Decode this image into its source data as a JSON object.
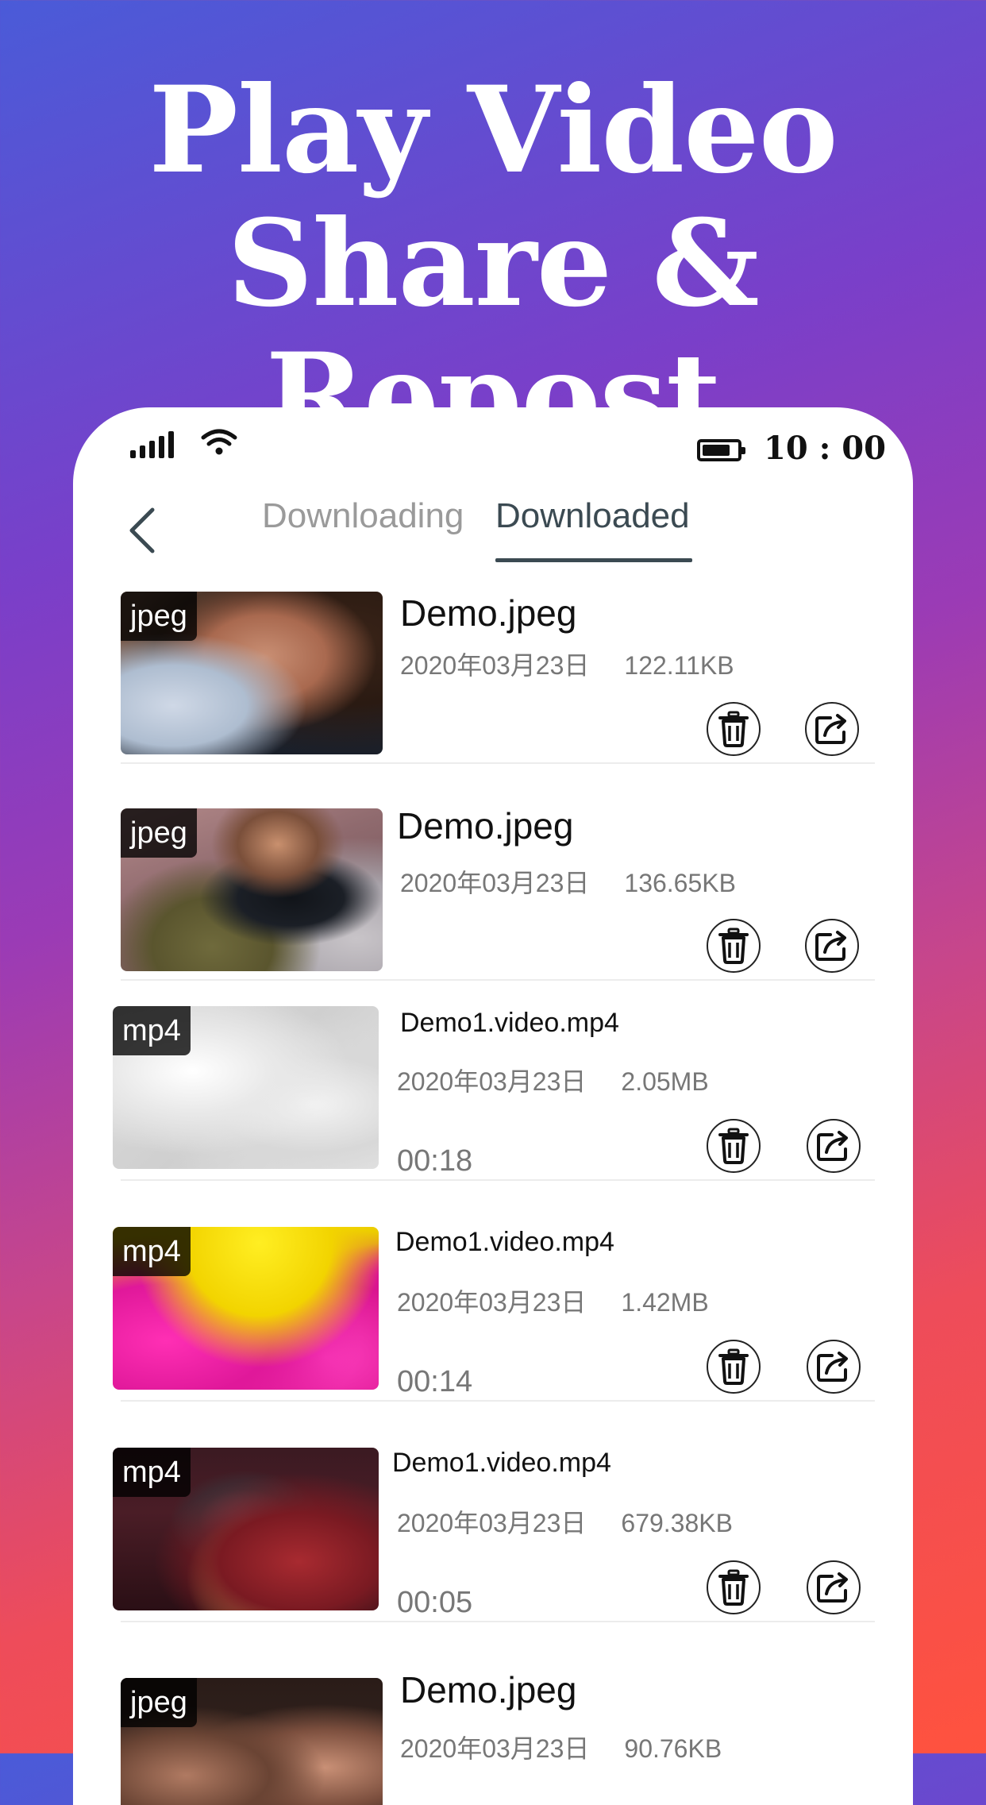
{
  "headline": {
    "line1": "Play Video",
    "line2": "Share & Repost"
  },
  "status_bar": {
    "time": "10 : 00"
  },
  "tabs": [
    {
      "label": "Downloading",
      "active": false
    },
    {
      "label": "Downloaded",
      "active": true
    }
  ],
  "items": [
    {
      "type": "jpeg",
      "name": "Demo.jpeg",
      "date": "2020年03月23日",
      "size": "122.11KB",
      "duration": ""
    },
    {
      "type": "jpeg",
      "name": "Demo.jpeg",
      "date": "2020年03月23日",
      "size": "136.65KB",
      "duration": ""
    },
    {
      "type": "mp4",
      "name": "Demo1.video.mp4",
      "date": "2020年03月23日",
      "size": "2.05MB",
      "duration": "00:18"
    },
    {
      "type": "mp4",
      "name": "Demo1.video.mp4",
      "date": "2020年03月23日",
      "size": "1.42MB",
      "duration": "00:14"
    },
    {
      "type": "mp4",
      "name": "Demo1.video.mp4",
      "date": "2020年03月23日",
      "size": "679.38KB",
      "duration": "00:05"
    },
    {
      "type": "jpeg",
      "name": "Demo.jpeg",
      "date": "2020年03月23日",
      "size": "90.76KB",
      "duration": ""
    }
  ],
  "icons": {
    "back": "chevron-left-icon",
    "delete": "trash-icon",
    "share": "share-icon",
    "signal": "signal-icon",
    "wifi": "wifi-icon",
    "battery": "battery-icon"
  },
  "colors": {
    "tab_active": "#3b4a52",
    "tab_inactive": "#9a9a9a",
    "gradient_top": "#4a5bd8",
    "gradient_bottom": "#ff523e"
  }
}
